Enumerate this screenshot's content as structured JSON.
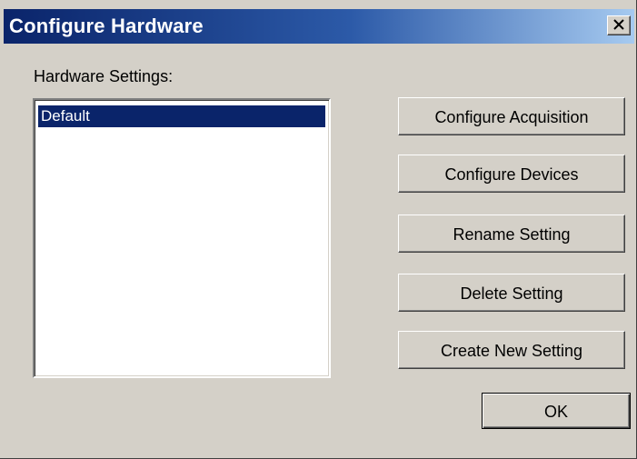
{
  "window": {
    "title": "Configure Hardware",
    "close_icon": "close-x-icon"
  },
  "settings": {
    "label": "Hardware Settings:",
    "items": [
      {
        "label": "Default",
        "selected": true
      }
    ]
  },
  "buttons": {
    "configure_acquisition": "Configure Acquisition",
    "configure_devices": "Configure Devices",
    "rename_setting": "Rename Setting",
    "delete_setting": "Delete Setting",
    "create_new_setting": "Create New Setting",
    "ok": "OK"
  },
  "colors": {
    "titlebar_start": "#0a246a",
    "titlebar_end": "#a6caf0",
    "face": "#d4d0c8",
    "selection": "#0a246a"
  }
}
